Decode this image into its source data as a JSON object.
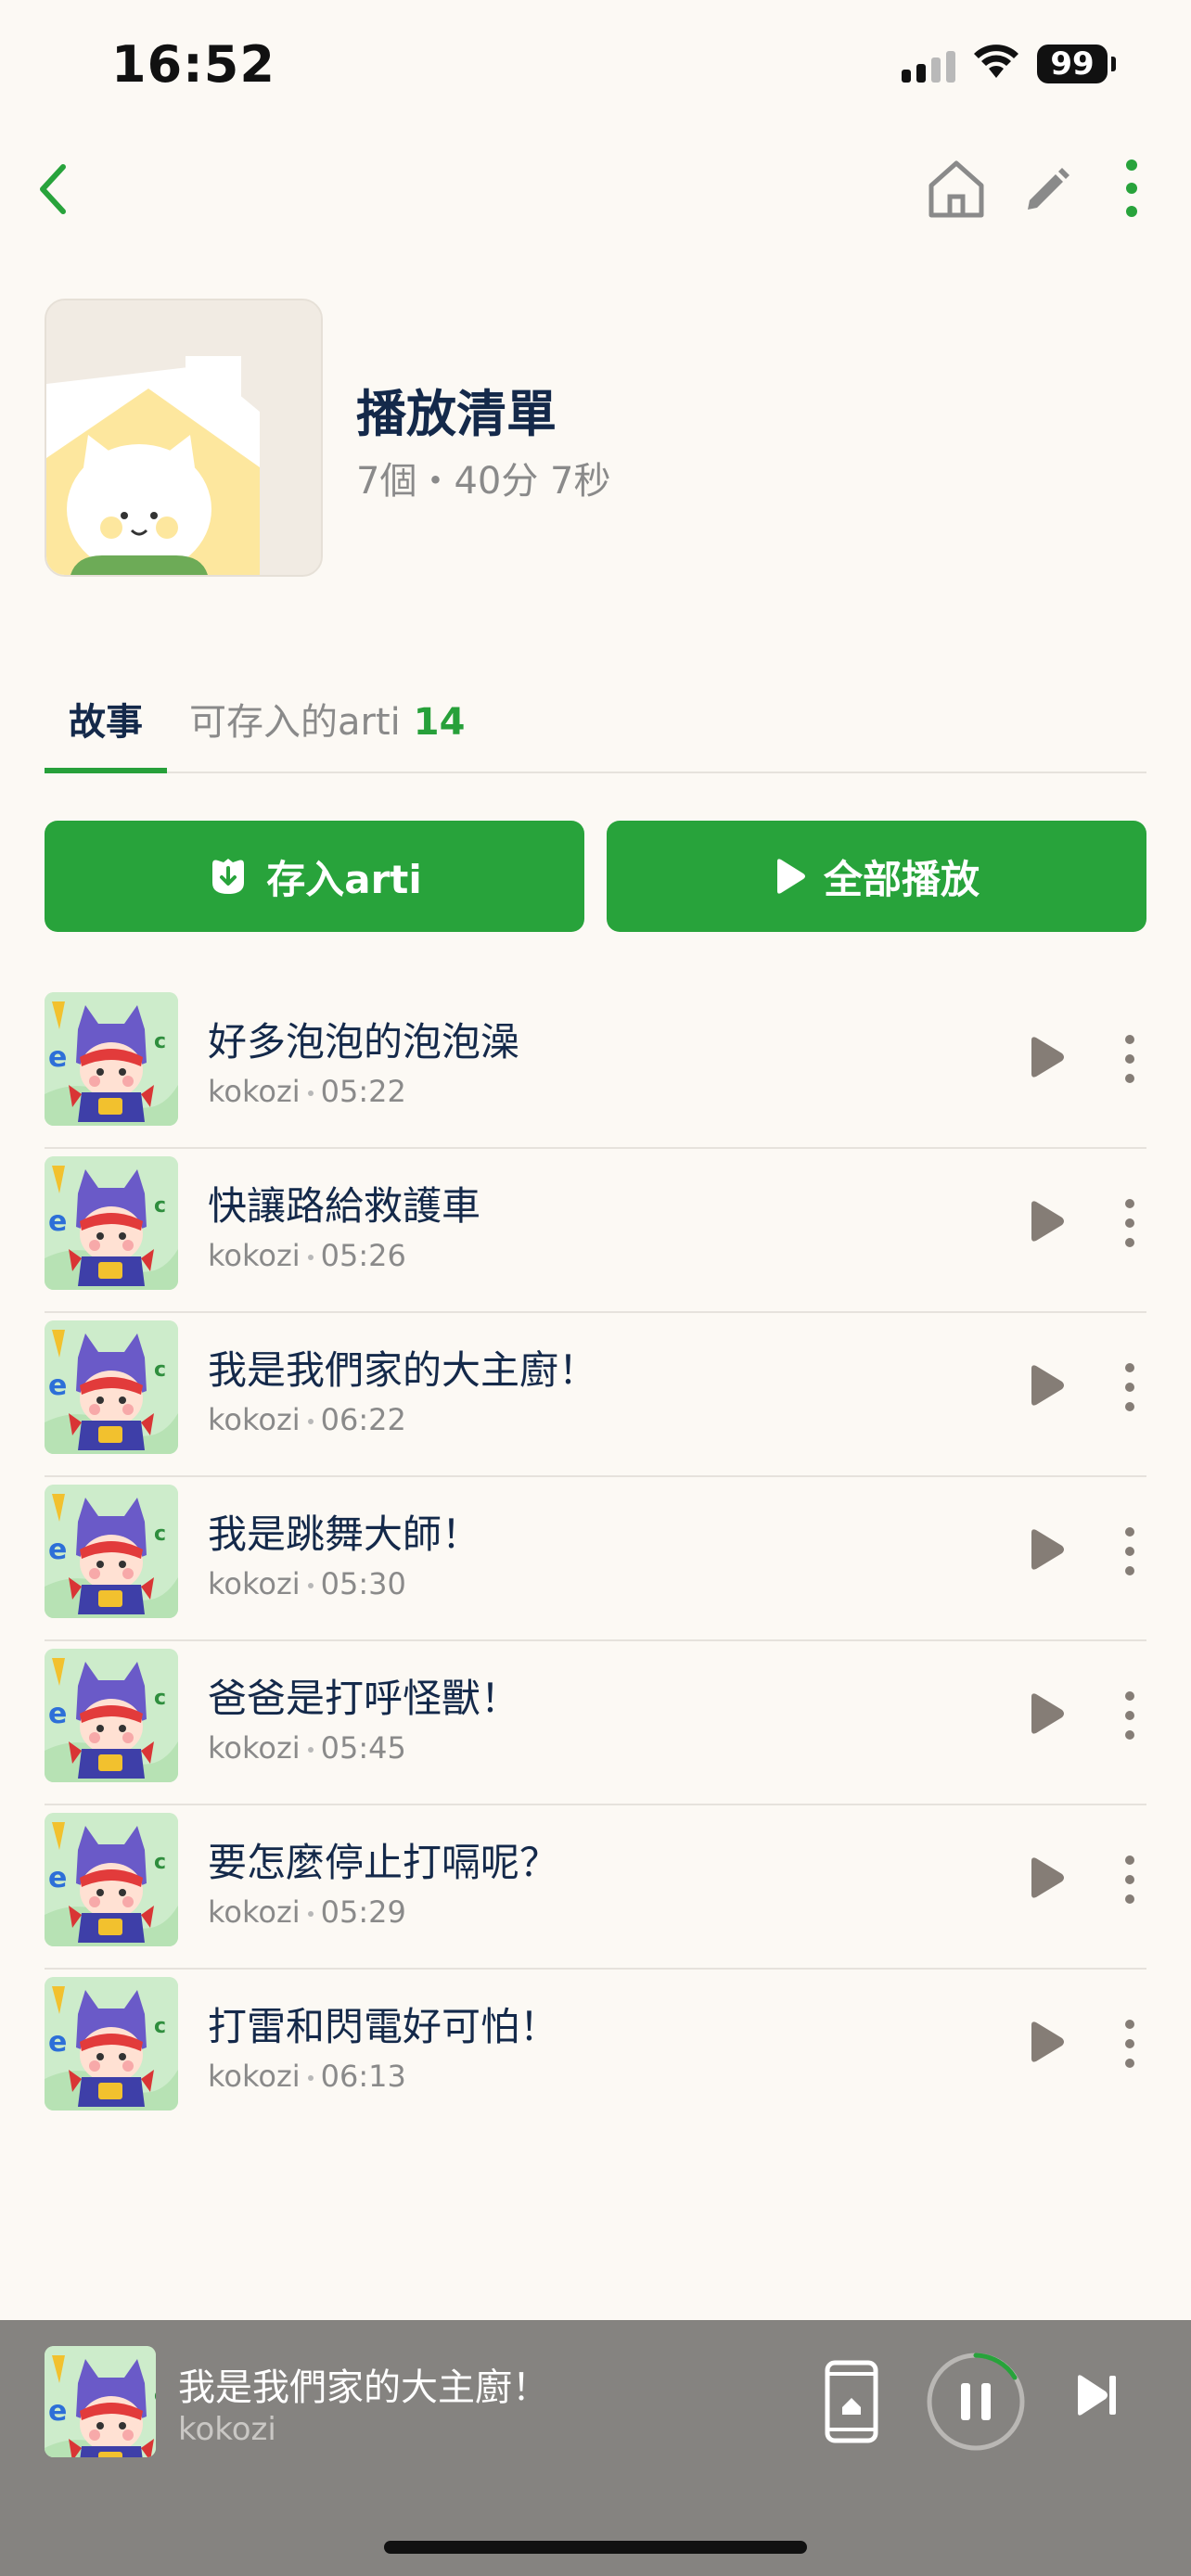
{
  "status": {
    "time": "16:52",
    "battery": "99"
  },
  "playlist": {
    "title": "播放清單",
    "meta": "7個・40分 7秒"
  },
  "tabs": {
    "story": "故事",
    "arti_label": "可存入的arti",
    "arti_count": "14"
  },
  "buttons": {
    "save": "存入arti",
    "play_all": "全部播放"
  },
  "tracks": [
    {
      "title": "好多泡泡的泡泡澡",
      "author": "kokozi",
      "duration": "05:22"
    },
    {
      "title": "快讓路給救護車",
      "author": "kokozi",
      "duration": "05:26"
    },
    {
      "title": "我是我們家的大主廚！",
      "author": "kokozi",
      "duration": "06:22"
    },
    {
      "title": "我是跳舞大師！",
      "author": "kokozi",
      "duration": "05:30"
    },
    {
      "title": "爸爸是打呼怪獸！",
      "author": "kokozi",
      "duration": "05:45"
    },
    {
      "title": "要怎麼停止打嗝呢？",
      "author": "kokozi",
      "duration": "05:29"
    },
    {
      "title": "打雷和閃電好可怕！",
      "author": "kokozi",
      "duration": "06:13"
    }
  ],
  "now_playing": {
    "title": "我是我們家的大主廚！",
    "author": "kokozi"
  },
  "colors": {
    "accent": "#28a33b",
    "background": "#fcf9f4",
    "title": "#14294a",
    "player_bg": "#858380"
  },
  "icons": [
    "back-icon",
    "home-icon",
    "edit-icon",
    "more-icon",
    "save-arti-icon",
    "play-icon",
    "device-icon",
    "pause-icon",
    "next-icon"
  ]
}
